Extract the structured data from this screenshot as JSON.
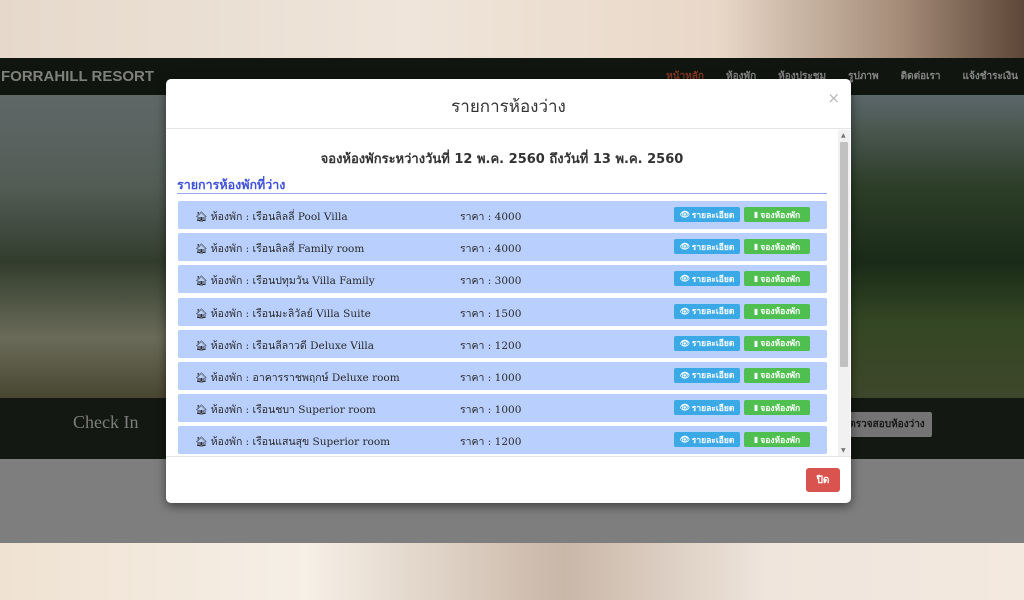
{
  "site": {
    "brand": "FORRAHILL RESORT",
    "nav": [
      "หน้าหลัก",
      "ห้องพัก",
      "ห้องประชุม",
      "รูปภาพ",
      "ติดต่อเรา",
      "แจ้งชำระเงิน"
    ],
    "checkin_label": "Check In",
    "check_button": "ตรวจสอบห้องว่าง"
  },
  "modal": {
    "title": "รายการห้องว่าง",
    "close_symbol": "×",
    "heading": "จองห้องพักระหว่างวันที่ 12 พ.ค. 2560 ถึงวันที่ 13 พ.ค. 2560",
    "section_title": "รายการห้องพักที่ว่าง",
    "detail_label": "รายละเอียด",
    "book_label": "จองห้องพัก",
    "footer_close": "ปิด",
    "rooms": [
      {
        "name": "ห้องพัก : เรือนลิลลี่ Pool Villa",
        "price": "ราคา : 4000"
      },
      {
        "name": "ห้องพัก : เรือนลิลลี่ Family room",
        "price": "ราคา : 4000"
      },
      {
        "name": "ห้องพัก : เรือนปทุมวัน Villa Family",
        "price": "ราคา : 3000"
      },
      {
        "name": "ห้องพัก : เรือนมะลิวัลย์ Villa Suite",
        "price": "ราคา : 1500"
      },
      {
        "name": "ห้องพัก : เรือนลีลาวดี Deluxe Villa",
        "price": "ราคา : 1200"
      },
      {
        "name": "ห้องพัก : อาคารราชพฤกษ์ Deluxe room",
        "price": "ราคา : 1000"
      },
      {
        "name": "ห้องพัก : เรือนชบา Superior room",
        "price": "ราคา : 1000"
      },
      {
        "name": "ห้องพัก : เรือนแสนสุข Superior room",
        "price": "ราคา : 1200"
      }
    ]
  },
  "icons": {
    "home": "home-icon",
    "eye": "eye-icon",
    "book": "book-icon"
  },
  "colors": {
    "row_bg": "#b9cffd",
    "detail_btn": "#3aa9e6",
    "book_btn": "#4fbf4f",
    "close_btn": "#d9534f",
    "section_title": "#3f51d9",
    "nav_active": "#e0603b"
  }
}
